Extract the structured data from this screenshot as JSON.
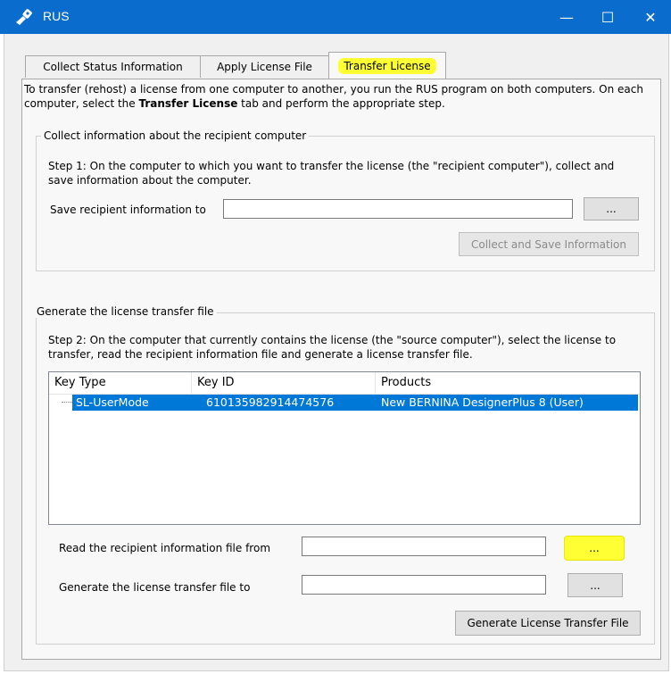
{
  "window": {
    "title": "RUS",
    "minimize_glyph": "—",
    "maximize_glyph": "☐",
    "close_glyph": "✕"
  },
  "tabs": [
    {
      "label": "Collect Status Information"
    },
    {
      "label": "Apply License File"
    },
    {
      "label": "Transfer License"
    }
  ],
  "intro": {
    "part1": "To transfer (rehost) a license from one computer to another, you run the RUS program on both computers. On each computer, select the ",
    "bold": "Transfer License",
    "part2": " tab and perform the appropriate step."
  },
  "recipient_group": {
    "title": "Collect information about the recipient computer",
    "step_text": "Step 1: On the computer to which you want to transfer the license (the \"recipient computer\"), collect and save information about the computer.",
    "save_label": "Save recipient information to",
    "save_value": "",
    "browse_label": "...",
    "collect_button": "Collect and Save Information"
  },
  "transfer_group": {
    "title": "Generate the license transfer file",
    "step_text": "Step 2: On the computer that currently contains the license (the \"source computer\"), select the license to transfer, read the recipient information file and generate a license transfer file.",
    "columns": [
      "Key Type",
      "Key ID",
      "Products"
    ],
    "rows": [
      {
        "key_type": "SL-UserMode",
        "key_id": "610135982914474576",
        "product": "New BERNINA DesignerPlus 8 (User)"
      }
    ],
    "read_label": "Read the recipient information file from",
    "read_value": "",
    "read_browse": "...",
    "generate_label": "Generate the license transfer file to",
    "generate_value": "",
    "generate_browse": "...",
    "generate_button": "Generate License Transfer File"
  },
  "colors": {
    "titlebar": "#0a6ccc",
    "highlight": "#ffff33",
    "selection": "#0078d7"
  }
}
